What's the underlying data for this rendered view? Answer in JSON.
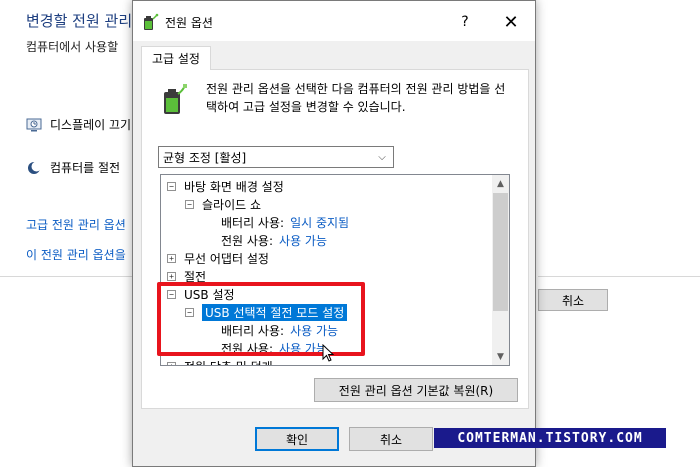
{
  "background": {
    "title": "변경할 전원 관리",
    "description": "컴퓨터에서 사용할",
    "rows": [
      {
        "icon": "display-icon",
        "label": "디스플레이 끄기"
      },
      {
        "icon": "sleep-moon-icon",
        "label": "컴퓨터를 절전"
      }
    ],
    "links": [
      "고급 전원 관리 옵션",
      "이 전원 관리 옵션을"
    ],
    "cancel_label": "취소"
  },
  "dialog": {
    "title": "전원 옵션",
    "help_label": "?",
    "close_label": "✕",
    "tab_label": "고급 설정",
    "description": "전원 관리 옵션을 선택한 다음 컴퓨터의 전원 관리 방법을 선택하여 고급 설정을 변경할 수 있습니다.",
    "plan_select_value": "균형 조정 [활성]",
    "tree": [
      {
        "label": "바탕 화면 배경 설정",
        "expander": "−"
      },
      {
        "label": "슬라이드 쇼",
        "expander": "−"
      },
      {
        "label": "배터리 사용:",
        "value": "일시 중지됨"
      },
      {
        "label": "전원 사용:",
        "value": "사용 가능"
      },
      {
        "label": "무선 어댑터 설정",
        "expander": "+"
      },
      {
        "label": "절전",
        "expander": "+"
      },
      {
        "label": "USB 설정",
        "expander": "−"
      },
      {
        "label": "USB 선택적 절전 모드 설정",
        "expander": "−"
      },
      {
        "label": "배터리 사용:",
        "value": "사용 가능"
      },
      {
        "label": "전원 사용:",
        "value": "사용 가능"
      },
      {
        "label": "전원 단추 및 덮개",
        "expander": "+"
      }
    ],
    "restore_label": "전원 관리 옵션 기본값 복원(R)",
    "ok_label": "확인",
    "cancel_label": "취소"
  },
  "watermark": "COMTERMAN.TISTORY.COM",
  "colors": {
    "accent": "#0078d7",
    "link": "#0b5cc4",
    "highlight": "#e8141d",
    "watermark_bg": "#1a1a8c"
  }
}
